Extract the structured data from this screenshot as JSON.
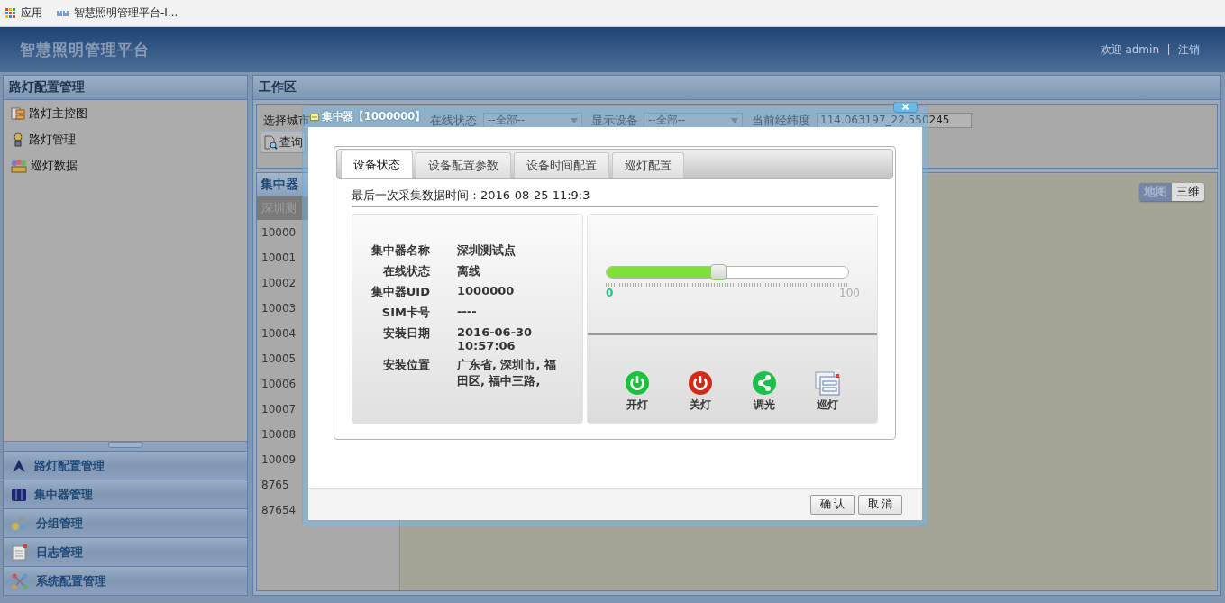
{
  "browser_bar": {
    "apps_label": "应用",
    "bookmark": "智慧照明管理平台-I..."
  },
  "header": {
    "title": "智慧照明管理平台",
    "welcome": "欢迎 admin",
    "logout": "注销"
  },
  "sidebar": {
    "title": "路灯配置管理",
    "items": [
      {
        "label": "路灯主控图"
      },
      {
        "label": "路灯管理"
      },
      {
        "label": "巡灯数据"
      }
    ],
    "sections": [
      {
        "label": "路灯配置管理"
      },
      {
        "label": "集中器管理"
      },
      {
        "label": "分组管理"
      },
      {
        "label": "日志管理"
      },
      {
        "label": "系统配置管理"
      }
    ]
  },
  "workspace": {
    "title": "工作区",
    "filters": {
      "city_label": "选择城市",
      "online_label": "在线状态",
      "online_value": "--全部--",
      "device_label": "显示设备",
      "device_value": "--全部--",
      "coords_label": "当前经纬度",
      "coords_value": "114.063197_22.550245",
      "query_button": "查询"
    },
    "list": {
      "title": "集中器",
      "header": "深圳测",
      "rows": [
        "10000",
        "10001",
        "10002",
        "10003",
        "10004",
        "10005",
        "10006",
        "10007",
        "10008",
        "10009",
        "8765",
        "87654"
      ]
    },
    "map": {
      "modes": [
        {
          "label": "地图",
          "selected": true
        },
        {
          "label": "三维",
          "selected": false
        }
      ]
    }
  },
  "dialog": {
    "title": "集中器【1000000】",
    "tabs": [
      {
        "label": "设备状态",
        "selected": true
      },
      {
        "label": "设备配置参数",
        "selected": false
      },
      {
        "label": "设备时间配置",
        "selected": false
      },
      {
        "label": "巡灯配置",
        "selected": false
      }
    ],
    "last_collect": "最后一次采集数据时间：2016-08-25 11:9:3",
    "fields": [
      {
        "label": "集中器名称",
        "value": "深圳测试点"
      },
      {
        "label": "在线状态",
        "value": "离线"
      },
      {
        "label": "集中器UID",
        "value": "1000000"
      },
      {
        "label": "SIM卡号",
        "value": "----"
      },
      {
        "label": "安装日期",
        "value": "2016-06-30 10:57:06"
      },
      {
        "label": "安装位置",
        "value": "广东省, 深圳市, 福田区, 福中三路,"
      }
    ],
    "dimmer": {
      "level": 0.46,
      "min": "0",
      "max": "100"
    },
    "actions": [
      {
        "label": "开灯",
        "kind": "power-on"
      },
      {
        "label": "关灯",
        "kind": "power-off"
      },
      {
        "label": "调光",
        "kind": "dim"
      },
      {
        "label": "巡灯",
        "kind": "patrol"
      }
    ],
    "buttons": [
      "确 认",
      "取 消"
    ]
  }
}
